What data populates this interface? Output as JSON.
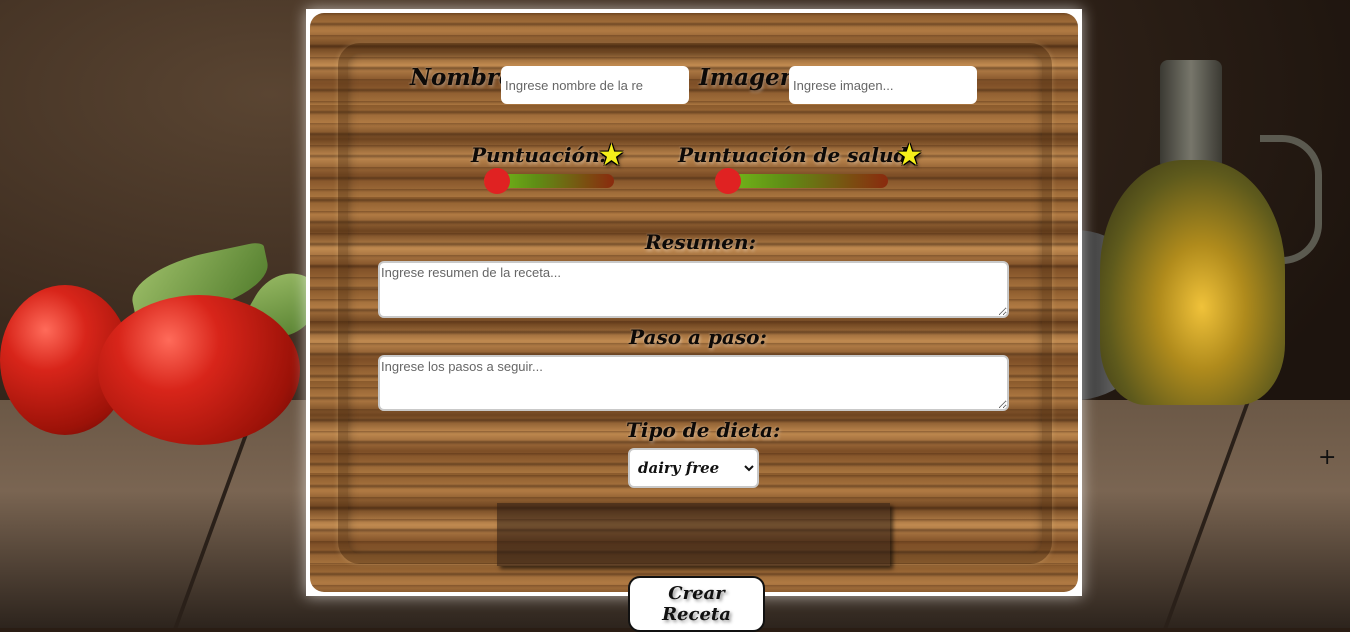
{
  "form": {
    "name_label": "Nombre:",
    "name_placeholder": "Ingrese nombre de la re",
    "image_label": "Imagen:",
    "image_placeholder": "Ingrese imagen...",
    "score_label": "Puntuación:",
    "health_score_label": "Puntuación de salud:",
    "score_value_fraction": 0,
    "health_score_value_fraction": 0,
    "summary_label": "Resumen:",
    "summary_placeholder": "Ingrese resumen de la receta...",
    "steps_label": "Paso a paso:",
    "steps_placeholder": "Ingrese los pasos a seguir...",
    "diet_label": "Tipo de dieta:",
    "diet_selected": "dairy free",
    "submit_label": "Crear Receta"
  },
  "colors": {
    "slider_start": "#77c21a",
    "slider_end": "#8a2a0e",
    "knob": "#e02222",
    "star": "#f5ef1a"
  },
  "icons": {
    "star": "star-icon",
    "cursor": "crosshair-cursor-icon"
  }
}
